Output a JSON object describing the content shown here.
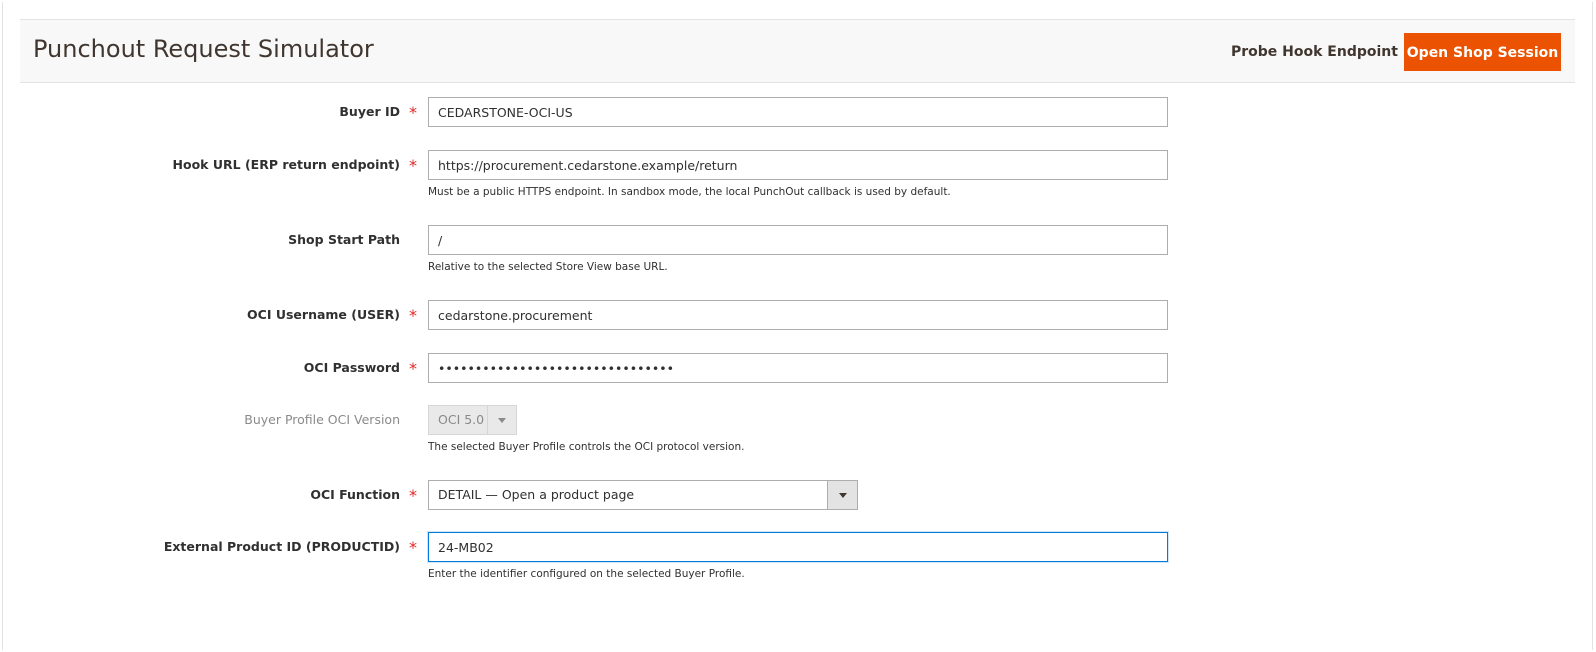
{
  "header": {
    "title": "Punchout Request Simulator",
    "probe_button": "Probe Hook Endpoint",
    "open_shop_button": "Open Shop Session"
  },
  "colors": {
    "primary_button": "#eb5202",
    "required_star": "#e22626",
    "focus_border": "#007bdb"
  },
  "fields": {
    "buyer_id": {
      "label": "Buyer ID",
      "required": "*",
      "value": "CEDARSTONE-OCI-US"
    },
    "hook_url": {
      "label": "Hook URL (ERP return endpoint)",
      "required": "*",
      "value": "https://procurement.cedarstone.example/return",
      "note": "Must be a public HTTPS endpoint. In sandbox mode, the local PunchOut callback is used by default."
    },
    "shop_start_path": {
      "label": "Shop Start Path",
      "value": "/",
      "note": "Relative to the selected Store View base URL."
    },
    "oci_username": {
      "label": "OCI Username (USER)",
      "required": "*",
      "value": "cedarstone.procurement"
    },
    "oci_password": {
      "label": "OCI Password",
      "required": "*",
      "value": "••••••••••••••••••••••••••••••••"
    },
    "oci_version": {
      "label": "Buyer Profile OCI Version",
      "selected": "OCI 5.0",
      "note": "The selected Buyer Profile controls the OCI protocol version."
    },
    "oci_function": {
      "label": "OCI Function",
      "required": "*",
      "selected": "DETAIL — Open a product page"
    },
    "product_id": {
      "label": "External Product ID (PRODUCTID)",
      "required": "*",
      "value": "24-MB02",
      "note": "Enter the identifier configured on the selected Buyer Profile."
    }
  }
}
